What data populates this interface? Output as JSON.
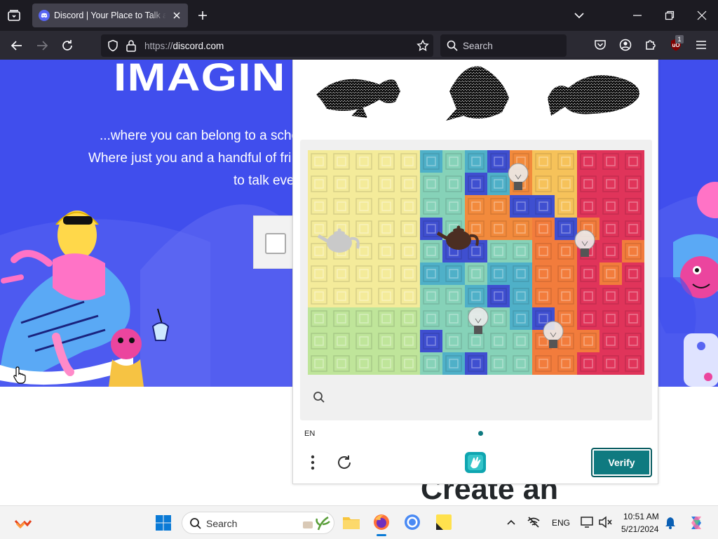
{
  "browser": {
    "tab_title": "Discord | Your Place to Talk and Hang Out",
    "url_scheme": "https://",
    "url_host": "discord.com",
    "search_placeholder": "Search",
    "extension_badge": "1"
  },
  "page": {
    "headline": "IMAGIN",
    "tagline_1": "...where you can belong to a scho",
    "tagline_2": "Where just you and a handful of fri",
    "tagline_3": "to talk eve",
    "create_heading": "Create an"
  },
  "captcha": {
    "language": "EN",
    "verify_label": "Verify",
    "colors": {
      "accent": "#0f7a80"
    }
  },
  "taskbar": {
    "search_placeholder": "Search",
    "language": "ENG",
    "time": "10:51 AM",
    "date": "5/21/2024"
  },
  "colors": {
    "discord_blurple": "#404eed",
    "browser_chrome": "#1c1b22"
  }
}
